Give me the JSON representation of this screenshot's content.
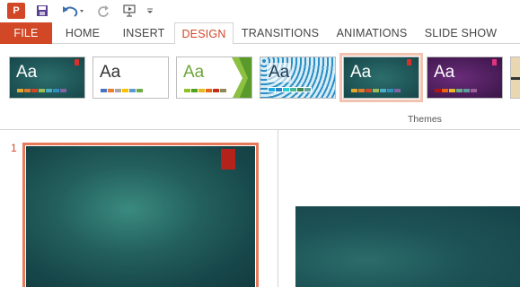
{
  "quick_access": {
    "icons": [
      "powerpoint-logo",
      "save-icon",
      "undo-icon",
      "redo-icon",
      "start-from-beginning-icon",
      "customize-qat-icon"
    ],
    "logo_letter": "P"
  },
  "tabs": [
    {
      "label": "FILE"
    },
    {
      "label": "HOME"
    },
    {
      "label": "INSERT"
    },
    {
      "label": "DESIGN"
    },
    {
      "label": "TRANSITIONS"
    },
    {
      "label": "ANIMATIONS"
    },
    {
      "label": "SLIDE SHOW"
    }
  ],
  "active_tab": "DESIGN",
  "themes": {
    "group_label": "Themes",
    "items": [
      {
        "label": "Aa",
        "name": "Ion (dark teal)",
        "bg": "#1d4f55",
        "text": "#ffffff",
        "selected": false
      },
      {
        "label": "Aa",
        "name": "Office Theme",
        "bg": "#ffffff",
        "text": "#333333",
        "selected": false
      },
      {
        "label": "Aa",
        "name": "Facet",
        "bg": "#ffffff",
        "text": "#6fa53a",
        "selected": false
      },
      {
        "label": "Aa",
        "name": "Pattern",
        "bg": "#cfe8f5",
        "text": "#1e3b52",
        "selected": false
      },
      {
        "label": "Aa",
        "name": "Ion",
        "bg": "#1d5558",
        "text": "#ffffff",
        "selected": true
      },
      {
        "label": "Aa",
        "name": "Ion Boardroom",
        "bg": "#4a1e57",
        "text": "#ffffff",
        "selected": false
      }
    ]
  },
  "thumbnails": [
    {
      "number": "1"
    }
  ],
  "colors": {
    "accent": "#d24726",
    "selection_frame": "#e8795a",
    "slide_dark": "#17474a"
  }
}
